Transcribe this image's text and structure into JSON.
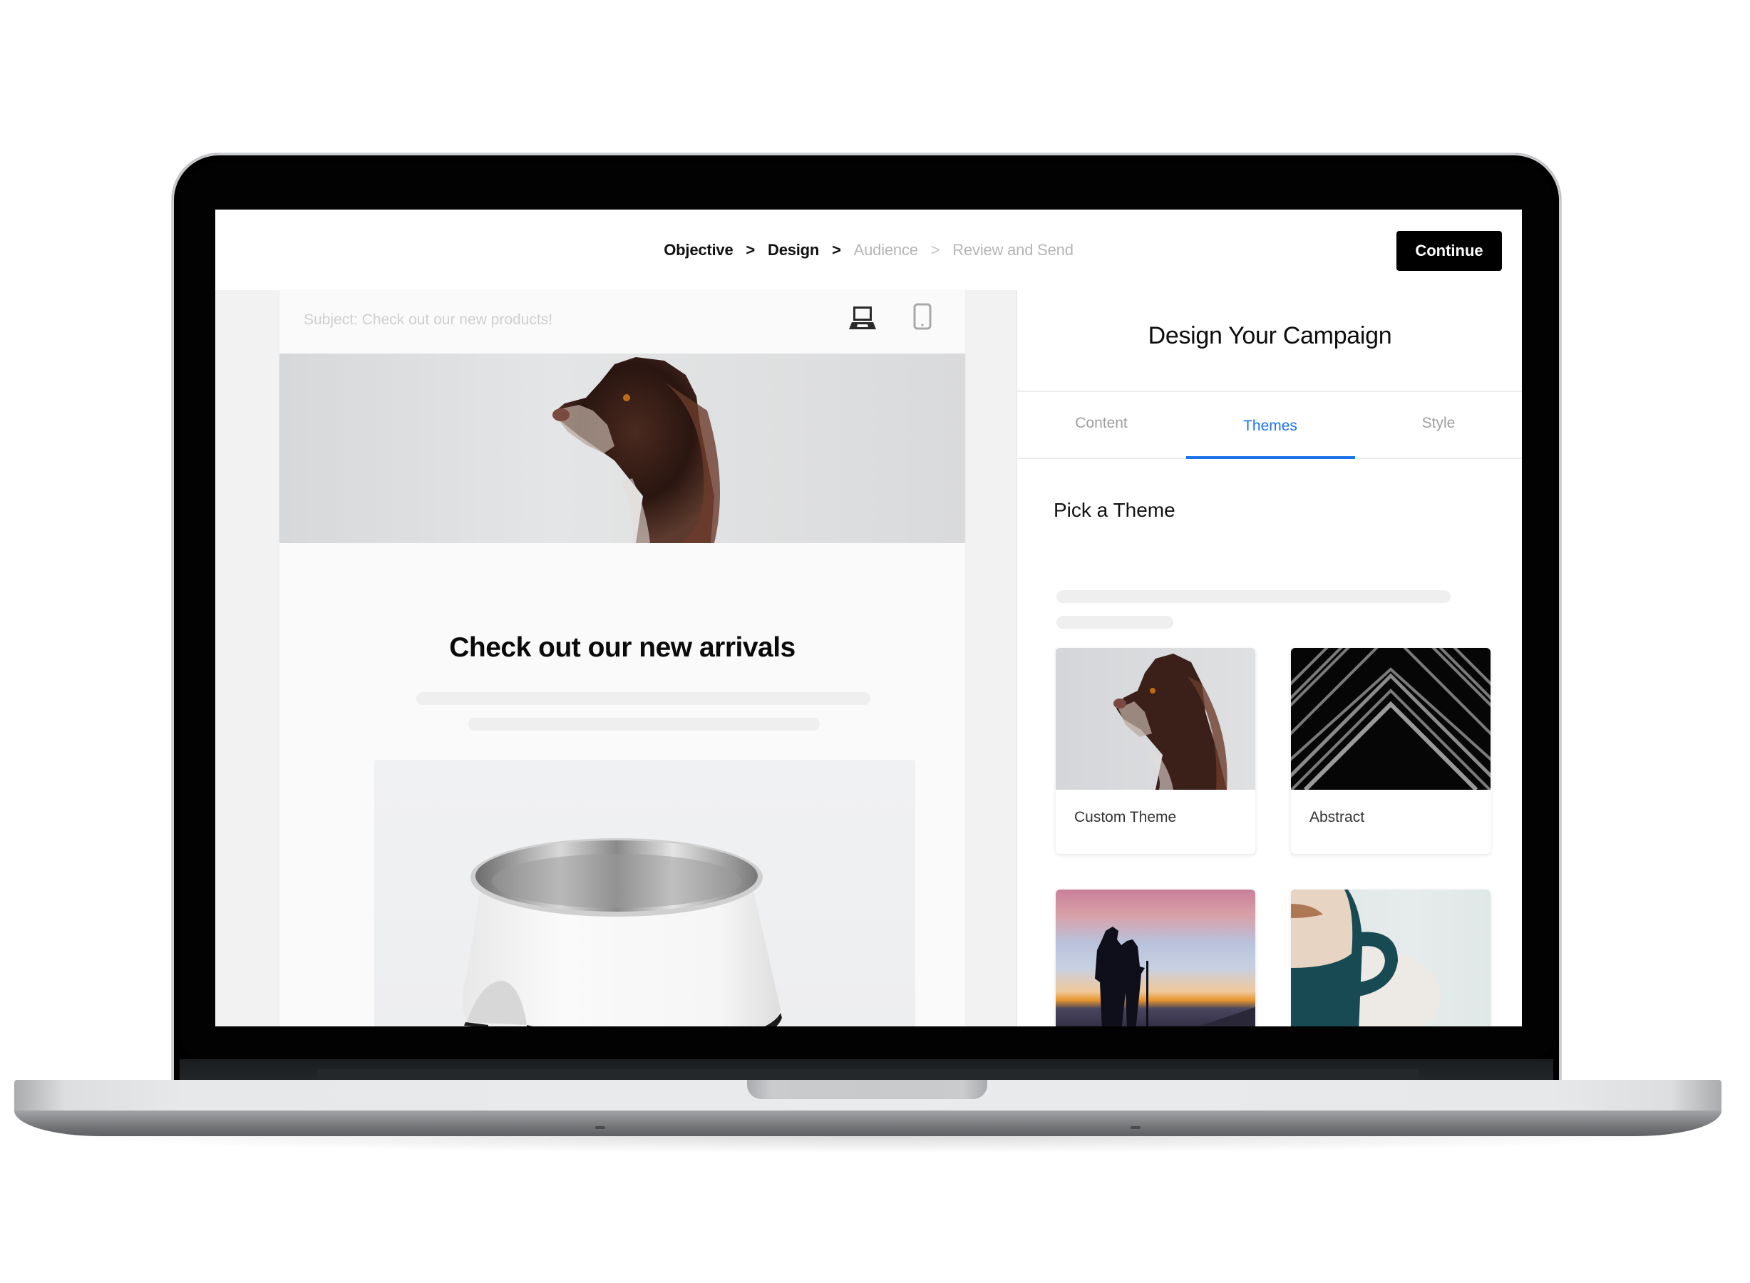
{
  "device": "laptop-mockup",
  "header": {
    "breadcrumbs": [
      {
        "label": "Objective",
        "state": "completed"
      },
      {
        "label": "Design",
        "state": "current"
      },
      {
        "label": "Audience",
        "state": "upcoming"
      },
      {
        "label": "Review and Send",
        "state": "upcoming"
      }
    ],
    "separator": ">",
    "continue_label": "Continue"
  },
  "email_preview": {
    "subject": "Subject: Check out our new products!",
    "view_modes": [
      {
        "icon": "laptop-icon",
        "selected": true
      },
      {
        "icon": "mobile-phone-icon",
        "selected": false
      }
    ],
    "hero_image": "dog-portrait",
    "headline": "Check out our new arrivals",
    "product_image": "white-pet-bowl"
  },
  "panel": {
    "title": "Design Your Campaign",
    "tabs": [
      {
        "label": "Content",
        "active": false
      },
      {
        "label": "Themes",
        "active": true
      },
      {
        "label": "Style",
        "active": false
      }
    ],
    "section_title": "Pick a Theme",
    "themes": [
      {
        "label": "Custom Theme",
        "image": "dog-portrait",
        "selected": true
      },
      {
        "label": "Abstract",
        "image": "abstract-black-lines",
        "selected": false
      },
      {
        "label": "",
        "image": "sunset-hikers",
        "selected": false
      },
      {
        "label": "",
        "image": "coffee-cup",
        "selected": false
      }
    ]
  },
  "colors": {
    "accent": "#1a73e8",
    "button_bg": "#000000",
    "button_text": "#ffffff",
    "inactive_text": "#b5b5b5"
  }
}
